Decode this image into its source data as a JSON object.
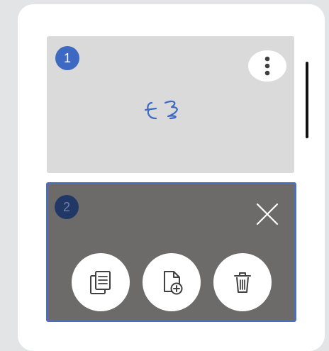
{
  "pages": [
    {
      "number": "1",
      "state": "default",
      "content": "handwritten-sketch",
      "menu_icon": "more-vertical-icon"
    },
    {
      "number": "2",
      "state": "selected",
      "actions": [
        {
          "name": "copy",
          "icon": "copy-page-icon"
        },
        {
          "name": "add",
          "icon": "add-page-icon"
        },
        {
          "name": "delete",
          "icon": "trash-icon"
        }
      ],
      "close_icon": "close-icon"
    }
  ],
  "colors": {
    "page_background": "#e3e4e6",
    "panel_background": "#ffffff",
    "page_1_background": "#d9dad9",
    "page_2_background": "#6c6b6a",
    "accent": "#3d69c3",
    "selected_border": "#4a6fc0",
    "ink": "#3d69c3"
  }
}
